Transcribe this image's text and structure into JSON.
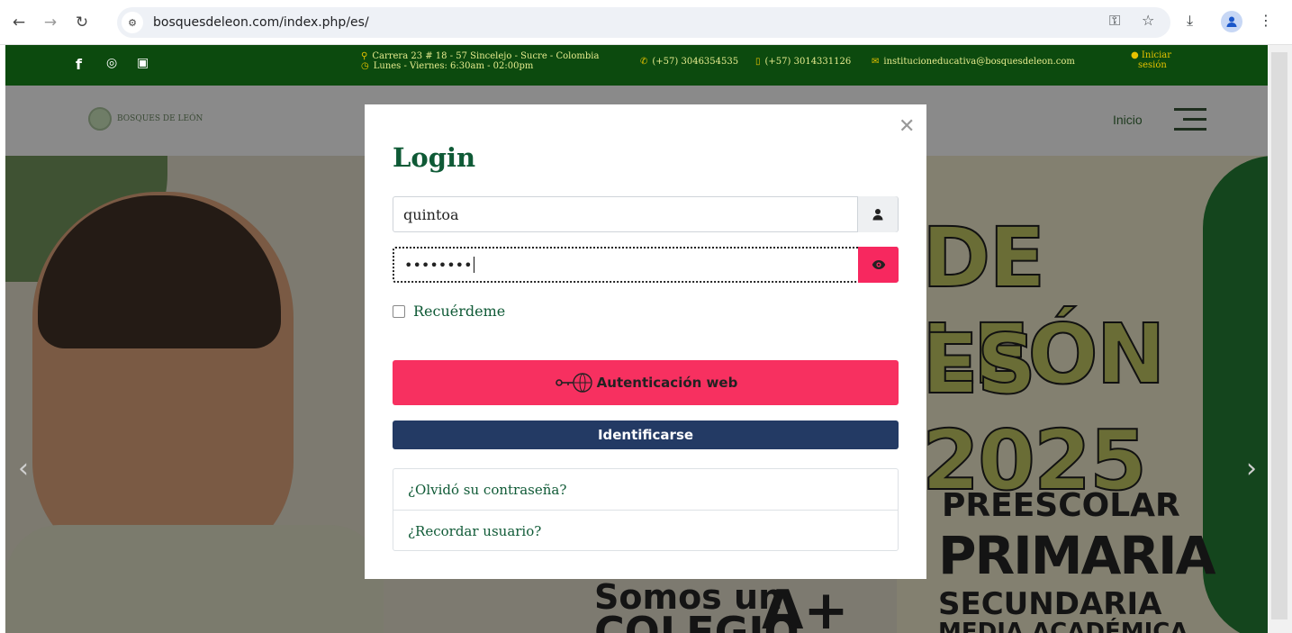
{
  "browser": {
    "url": "bosquesdeleon.com/index.php/es/",
    "back_icon": "back-arrow-icon",
    "forward_icon": "forward-arrow-icon",
    "reload_icon": "reload-icon"
  },
  "topbar": {
    "address_line1": "Carrera 23 # 18 - 57 Sincelejo - Sucre - Colombia",
    "address_line2": "Lunes - Viernes: 6:30am - 02:00pm",
    "phone1": "(+57) 3046354535",
    "phone2": "(+57) 3014331126",
    "email": "institucioneducativa@bosquesdeleon.com",
    "login_line1": "Iniciar",
    "login_line2": "sesión"
  },
  "header": {
    "logo_text": "BOSQUES DE LEÓN",
    "nav_inicio": "Inicio"
  },
  "hero": {
    "title_line1": "DE LEÓN",
    "title_line2": "ES 2025",
    "level1": "PREESCOLAR",
    "level2": "PRIMARIA",
    "level3": "SECUNDARIA",
    "level4": "MEDIA ACADÉMICA",
    "slogan1": "Somos un",
    "slogan2": "COLEGIO",
    "badge": "A+"
  },
  "modal": {
    "title": "Login",
    "username_value": "quintoa",
    "password_value": "••••••••",
    "remember_label": "Recuérdeme",
    "web_auth_label": "Autenticación web",
    "submit_label": "Identificarse",
    "forgot_password": "¿Olvidó su contraseña?",
    "forgot_username": "¿Recordar usuario?"
  },
  "colors": {
    "brand_green": "#0c4a0e",
    "accent_pink": "#f73060",
    "navy": "#233a64"
  }
}
